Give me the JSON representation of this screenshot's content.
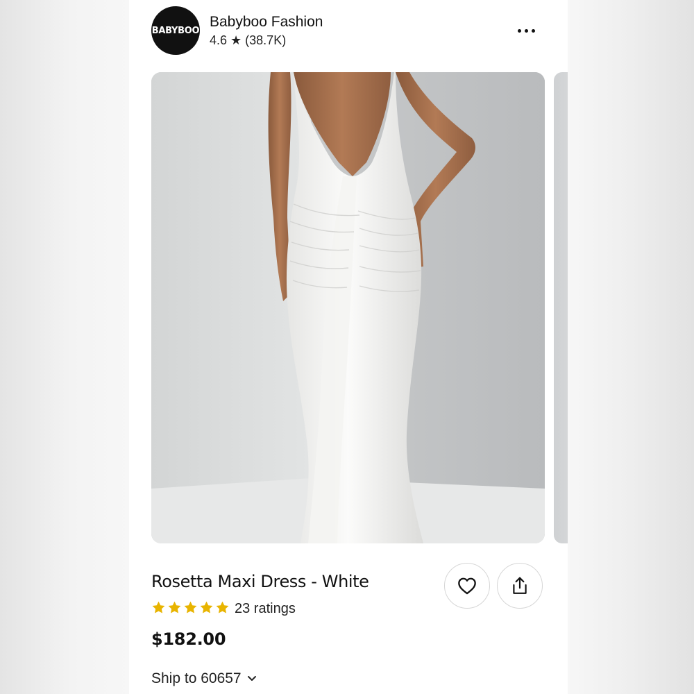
{
  "shop": {
    "logo_text": "BABYBOO",
    "name": "Babyboo Fashion",
    "rating_line": "4.6 ★ (38.7K)"
  },
  "header": {
    "more_icon": "more-horizontal-icon"
  },
  "product": {
    "title": "Rosetta Maxi Dress - White",
    "star_rating": 5,
    "ratings_text": "23 ratings",
    "price": "$182.00",
    "ship_to": "Ship to 60657"
  },
  "actions": {
    "favorite_icon": "heart-icon",
    "share_icon": "share-icon"
  },
  "colors": {
    "star": "#e8b400",
    "logo_bg": "#111111",
    "text": "#111111"
  }
}
